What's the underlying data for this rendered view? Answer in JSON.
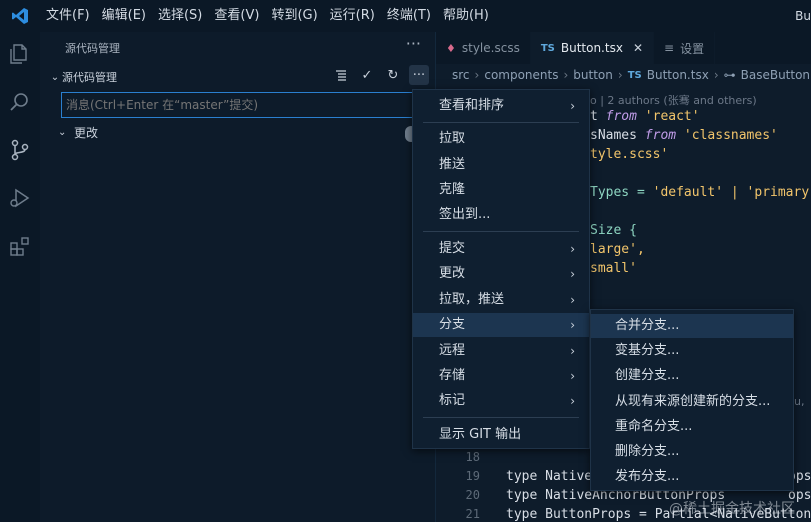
{
  "menubar": {
    "items": [
      "文件(F)",
      "编辑(E)",
      "选择(S)",
      "查看(V)",
      "转到(G)",
      "运行(R)",
      "终端(T)",
      "帮助(H)"
    ],
    "title": "Bu"
  },
  "sidebar": {
    "header": "源代码管理",
    "section_title": "源代码管理",
    "message_placeholder": "消息(Ctrl+Enter 在“master”提交)",
    "changes_label": "更改"
  },
  "tabs": [
    {
      "label": "style.scss",
      "icon": "scss-icon"
    },
    {
      "label": "Button.tsx",
      "icon": "ts-icon",
      "active": true
    },
    {
      "label": "设置",
      "icon": "settings-file-icon"
    }
  ],
  "breadcrumb": {
    "items": [
      "src",
      "components",
      "button",
      "Button.tsx",
      "BaseButtonP"
    ],
    "ts_badge": "TS"
  },
  "code": {
    "blame": "o | 2 authors (张骞 and others)",
    "lines": [
      {
        "a": "t ",
        "b": "from",
        "c": " 'react'"
      },
      {
        "a": "sNames ",
        "b": "from",
        "c": " 'classnames'"
      },
      {
        "a": "tyle.scss'",
        "b": "",
        "c": ""
      },
      {
        "a": "",
        "b": "",
        "c": ""
      },
      {
        "a": "Types = ",
        "b": "",
        "c": "'default' | 'primary'"
      },
      {
        "a": "",
        "b": "",
        "c": ""
      },
      {
        "a": "Size {",
        "b": "",
        "c": ""
      },
      {
        "a": "large',",
        "b": "",
        "c": ""
      },
      {
        "a": "small'",
        "b": "",
        "c": ""
      }
    ],
    "bottom_lines": [
      {
        "num": "18",
        "text": ""
      },
      {
        "num": "19",
        "text": "type Native",
        "tail": "ops"
      },
      {
        "num": "20",
        "text": "type NativeAnchorButtonProps",
        "tail": "ops"
      },
      {
        "num": "21",
        "text": "type ButtonProps = Partial<NativeButtonP"
      }
    ],
    "ghost_tail": "u,"
  },
  "context_menu": {
    "items": [
      {
        "label": "查看和排序",
        "submenu": true
      },
      {
        "label": "拉取"
      },
      {
        "label": "推送"
      },
      {
        "label": "克隆"
      },
      {
        "label": "签出到..."
      },
      {
        "label": "提交",
        "submenu": true
      },
      {
        "label": "更改",
        "submenu": true
      },
      {
        "label": "拉取，推送",
        "submenu": true
      },
      {
        "label": "分支",
        "submenu": true,
        "highlighted": true
      },
      {
        "label": "远程",
        "submenu": true
      },
      {
        "label": "存储",
        "submenu": true
      },
      {
        "label": "标记",
        "submenu": true
      },
      {
        "label": "显示 GIT 输出"
      }
    ]
  },
  "branch_submenu": {
    "items": [
      "合并分支...",
      "变基分支...",
      "创建分支...",
      "从现有来源创建新的分支...",
      "重命名分支...",
      "删除分支...",
      "发布分支..."
    ]
  },
  "watermark": "@稀土掘金技术社区",
  "colors": {
    "accent": "#2a7fcf",
    "background": "#0d1b2a",
    "highlight": "#1c3550"
  }
}
